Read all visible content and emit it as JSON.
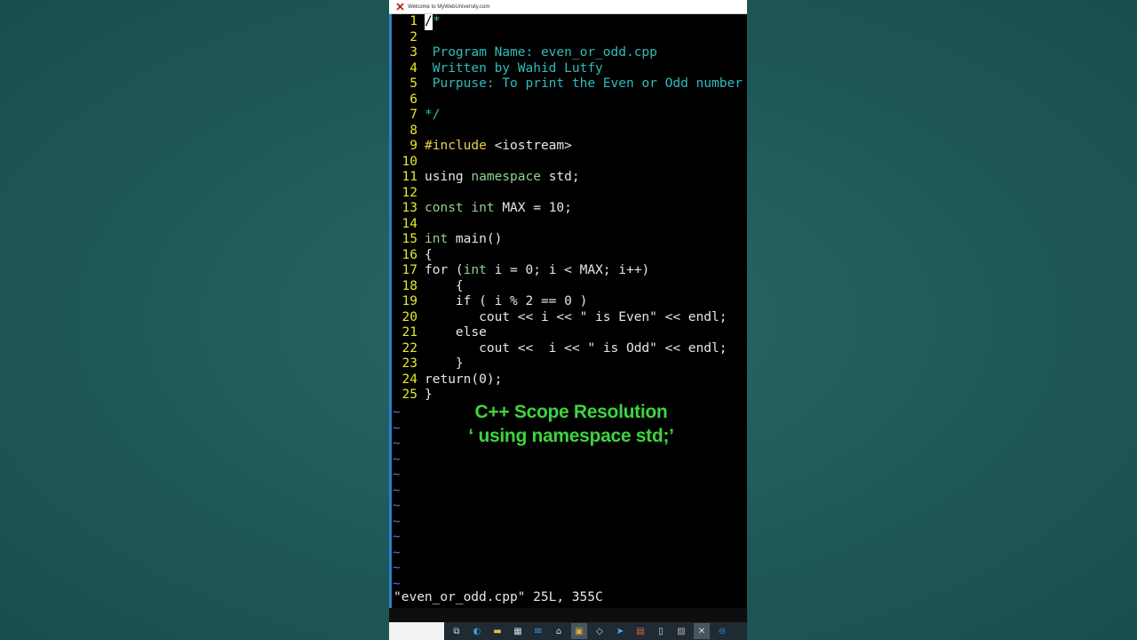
{
  "window": {
    "title": "Welcome to MyWebUniversity.com"
  },
  "editor": {
    "lines": [
      {
        "n": "1",
        "segs": [
          {
            "t": "/",
            "c": "cursor"
          },
          {
            "t": "*",
            "c": "c-comment"
          }
        ]
      },
      {
        "n": "2",
        "segs": []
      },
      {
        "n": "3",
        "segs": [
          {
            "t": " Program Name: even_or_odd.cpp",
            "c": "c-comment"
          }
        ]
      },
      {
        "n": "4",
        "segs": [
          {
            "t": " Written by Wahid Lutfy",
            "c": "c-comment"
          }
        ]
      },
      {
        "n": "5",
        "segs": [
          {
            "t": " Purpuse: To print the Even or Odd number",
            "c": "c-comment"
          }
        ]
      },
      {
        "n": "6",
        "segs": []
      },
      {
        "n": "7",
        "segs": [
          {
            "t": "*/",
            "c": "c-comment"
          }
        ]
      },
      {
        "n": "8",
        "segs": []
      },
      {
        "n": "9",
        "segs": [
          {
            "t": "#include",
            "c": "c-pre"
          },
          {
            "t": " <iostream>",
            "c": ""
          }
        ]
      },
      {
        "n": "10",
        "segs": []
      },
      {
        "n": "11",
        "segs": [
          {
            "t": "using ",
            "c": "c-kw"
          },
          {
            "t": "namespace",
            "c": "c-type"
          },
          {
            "t": " std;",
            "c": ""
          }
        ]
      },
      {
        "n": "12",
        "segs": []
      },
      {
        "n": "13",
        "segs": [
          {
            "t": "const ",
            "c": "c-type"
          },
          {
            "t": "int",
            "c": "c-type"
          },
          {
            "t": " MAX = 10;",
            "c": ""
          }
        ]
      },
      {
        "n": "14",
        "segs": []
      },
      {
        "n": "15",
        "segs": [
          {
            "t": "int",
            "c": "c-type"
          },
          {
            "t": " main()",
            "c": ""
          }
        ]
      },
      {
        "n": "16",
        "segs": [
          {
            "t": "{",
            "c": ""
          }
        ]
      },
      {
        "n": "17",
        "segs": [
          {
            "t": "for (",
            "c": ""
          },
          {
            "t": "int",
            "c": "c-type"
          },
          {
            "t": " i = 0; i < MAX; i++)",
            "c": ""
          }
        ]
      },
      {
        "n": "18",
        "segs": [
          {
            "t": "    {",
            "c": ""
          }
        ]
      },
      {
        "n": "19",
        "segs": [
          {
            "t": "    if ( i % 2 == 0 )",
            "c": ""
          }
        ]
      },
      {
        "n": "20",
        "segs": [
          {
            "t": "       cout << i << \" is Even\" << endl;",
            "c": ""
          }
        ]
      },
      {
        "n": "21",
        "segs": [
          {
            "t": "    else",
            "c": ""
          }
        ]
      },
      {
        "n": "22",
        "segs": [
          {
            "t": "       cout <<  i << \" is Odd\" << endl;",
            "c": ""
          }
        ]
      },
      {
        "n": "23",
        "segs": [
          {
            "t": "    }",
            "c": ""
          }
        ]
      },
      {
        "n": "24",
        "segs": [
          {
            "t": "return(0);",
            "c": ""
          }
        ]
      },
      {
        "n": "25",
        "segs": [
          {
            "t": "}",
            "c": ""
          }
        ]
      }
    ],
    "tilde": "~",
    "tilde_count": 12,
    "status": "\"even_or_odd.cpp\" 25L, 355C"
  },
  "overlay": {
    "line1": "C++  Scope Resolution",
    "line2": "‘ using namespace std;’"
  },
  "colors": {
    "comment": "#2fbcbc",
    "preprocessor": "#e8d24a",
    "type": "#8fd18f",
    "line_number": "#e8e82a",
    "overlay_text": "#3dd43d",
    "tilde": "#4a78c8"
  },
  "taskbar": {
    "icons": [
      "task-view-icon",
      "edge-icon",
      "file-explorer-icon",
      "calendar-icon",
      "mail-icon",
      "app-icon",
      "terminal-icon",
      "cube-icon",
      "share-icon",
      "document-icon",
      "file-icon",
      "image-icon",
      "x-app-icon",
      "minus-app-icon"
    ]
  }
}
